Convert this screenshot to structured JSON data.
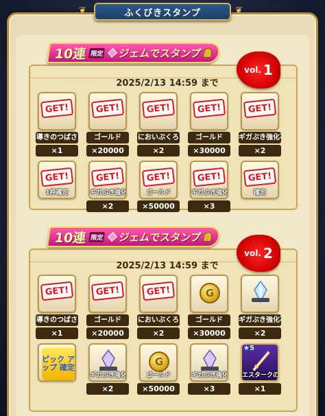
{
  "header": {
    "title": "ふくびきスタンプ"
  },
  "panels": [
    {
      "banner": {
        "big": "10連",
        "small": "限定",
        "mid": "ジェムでスタンプ"
      },
      "vol": {
        "prefix": "vol.",
        "num": "1"
      },
      "deadline": "2025/2/13  14:59  まで",
      "row1": [
        {
          "stamp": "GET!",
          "caption": "導きのつばさ",
          "qty": "×1"
        },
        {
          "stamp": "GET!",
          "caption": "ゴールド",
          "qty": "×20000"
        },
        {
          "stamp": "GET!",
          "caption": "においぶくろ",
          "qty": "×2"
        },
        {
          "stamp": "GET!",
          "caption": "ゴールド",
          "qty": "×30000"
        },
        {
          "stamp": "GET!",
          "caption": "ギガぶき強化石",
          "qty": "×2"
        }
      ],
      "row2": [
        {
          "stamp": "GET!",
          "inner": "1枠確定",
          "qty": ""
        },
        {
          "stamp": "GET!",
          "inner": "ギガぶき強化石",
          "qty": "×2"
        },
        {
          "stamp": "GET!",
          "inner": "ゴールド",
          "qty": "×50000"
        },
        {
          "stamp": "GET!",
          "inner": "ギガぶき強化石",
          "qty": "×3"
        },
        {
          "stamp": "GET!",
          "inner": "確定",
          "qty": ""
        }
      ]
    },
    {
      "banner": {
        "big": "10連",
        "small": "限定",
        "mid": "ジェムでスタンプ"
      },
      "vol": {
        "prefix": "vol.",
        "num": "2"
      },
      "deadline": "2025/2/13  14:59  まで",
      "row1": [
        {
          "stamp": "GET!",
          "caption": "導きのつばさ",
          "qty": "×1"
        },
        {
          "stamp": "GET!",
          "caption": "ゴールド",
          "qty": "×20000"
        },
        {
          "stamp": "GET!",
          "caption": "においぶくろ",
          "qty": "×2"
        },
        {
          "coin": "G",
          "caption": "ゴールド",
          "qty": "×30000"
        },
        {
          "caption": "ギガぶき強化石",
          "qty": "×2"
        }
      ],
      "row2": [
        {
          "pickup": "ピック アップ 確定",
          "qty": ""
        },
        {
          "inner": "ギガぶき強化石",
          "qty": "×2"
        },
        {
          "coin": "G",
          "inner": "ゴールド",
          "qty": "×50000"
        },
        {
          "inner": "ギガぶき強化石",
          "qty": "×3"
        },
        {
          "stars": "★5",
          "inner": "エスタークの魔刃",
          "qty": "×1"
        }
      ]
    }
  ]
}
